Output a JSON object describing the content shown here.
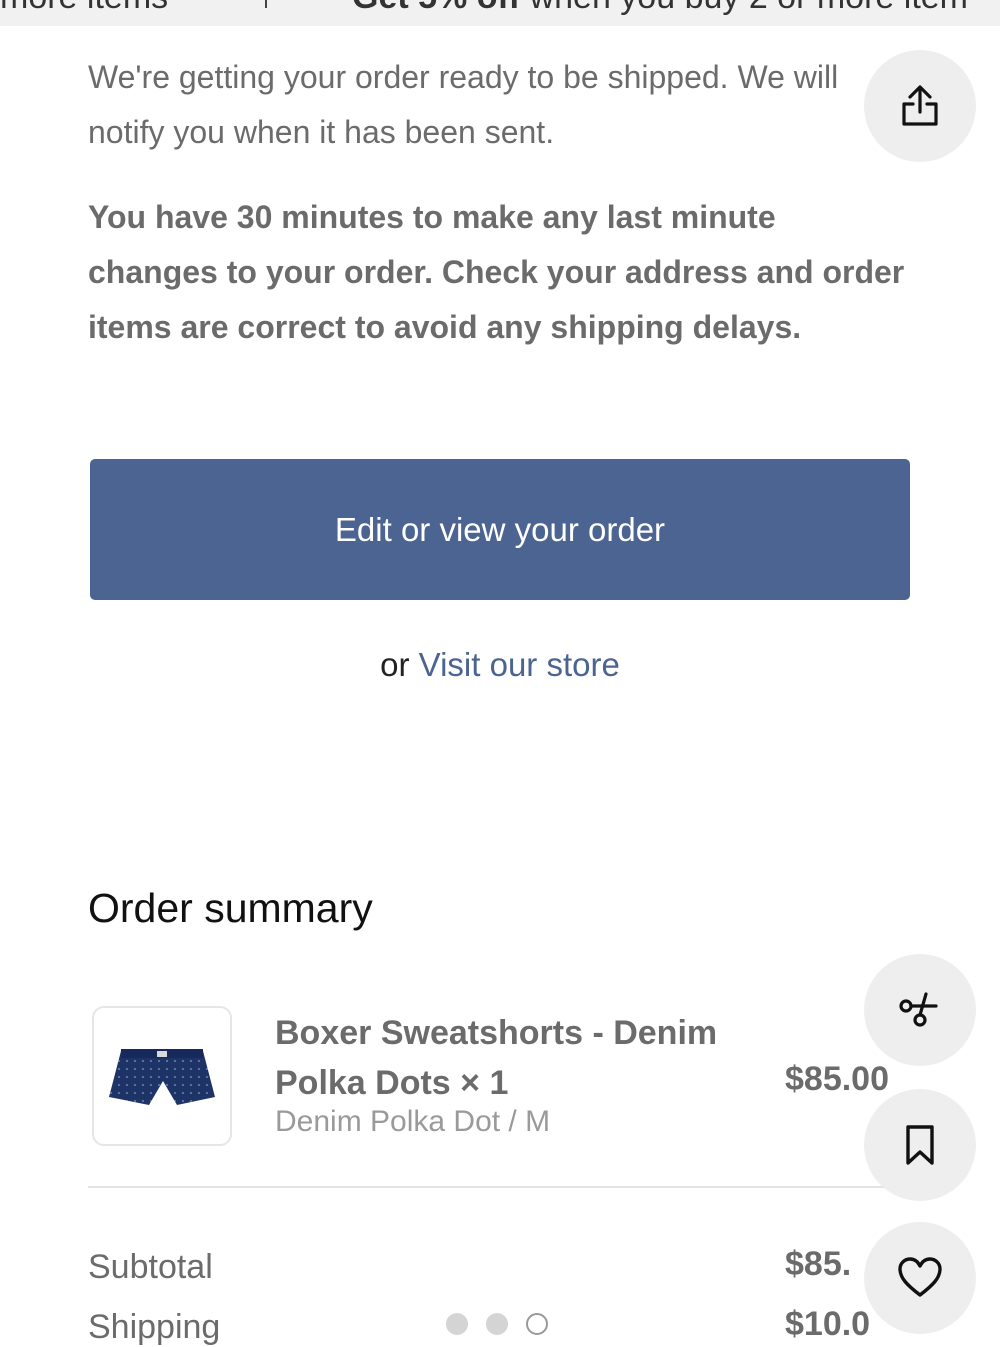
{
  "banner": {
    "left_text": "more items",
    "right_text_bold": "Get 5% off",
    "right_text": " when you buy 2 or more item"
  },
  "message": {
    "intro": "We're getting your order ready to be shipped. We will notify you when it has been sent.",
    "warning": "You have 30 minutes to make any last minute changes to your order. Check your address and order items are correct to avoid any shipping delays."
  },
  "actions": {
    "edit_order_label": "Edit or view your order",
    "or_text": "or",
    "visit_store_label": "Visit our store"
  },
  "order_summary": {
    "title": "Order summary",
    "items": [
      {
        "name": "Boxer Sweatshorts - Denim Polka Dots × 1",
        "variant": "Denim Polka Dot / M",
        "price": "$85.00",
        "image_icon": "denim-polka-dot-shorts"
      }
    ],
    "rows": [
      {
        "label": "Subtotal",
        "value": "$85."
      },
      {
        "label": "Shipping",
        "value": "$10.0"
      }
    ]
  },
  "pager": {
    "total": 3,
    "active_index": 2
  },
  "floating_actions": [
    {
      "icon": "share-icon"
    },
    {
      "icon": "scissors-icon"
    },
    {
      "icon": "bookmark-icon"
    },
    {
      "icon": "heart-icon"
    }
  ],
  "colors": {
    "primary_button": "#4c6491",
    "link": "#4c6491",
    "muted_text": "#6b6b6b",
    "fab_background": "#eeeeee"
  }
}
